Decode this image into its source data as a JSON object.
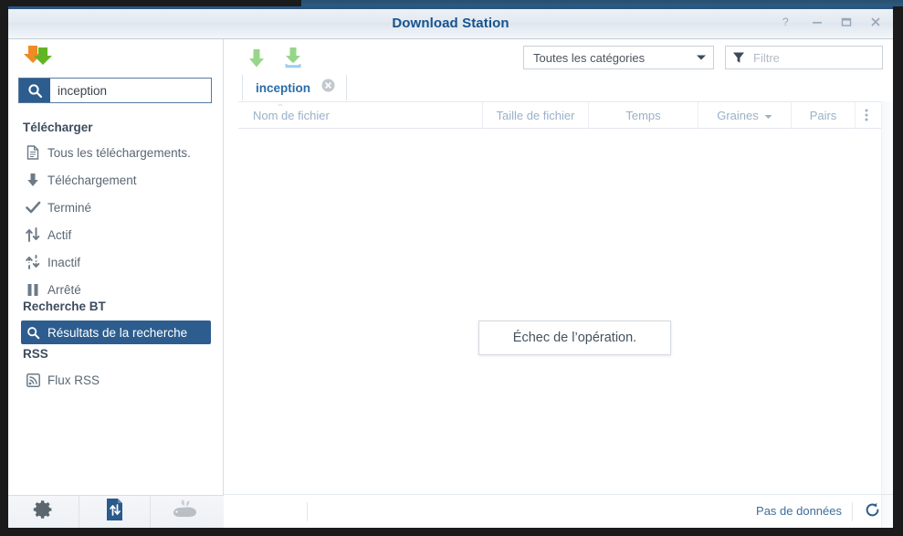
{
  "window": {
    "title": "Download Station",
    "controls": [
      {
        "name": "help-button",
        "icon": "question-icon"
      },
      {
        "name": "minimize-button",
        "icon": "minimize-icon"
      },
      {
        "name": "maximize-button",
        "icon": "maximize-icon"
      },
      {
        "name": "close-button",
        "icon": "close-icon"
      }
    ]
  },
  "sidebar": {
    "search": {
      "value": "inception",
      "placeholder": "",
      "icon": "search-icon",
      "clear_icon": "clear-circle-icon"
    },
    "groups": [
      {
        "title": "Télécharger",
        "items": [
          {
            "label": "Tous les téléchargements.",
            "icon": "document-icon",
            "selected": false
          },
          {
            "label": "Téléchargement",
            "icon": "download-arrow-icon",
            "selected": false
          },
          {
            "label": "Terminé",
            "icon": "check-icon",
            "selected": false
          },
          {
            "label": "Actif",
            "icon": "up-down-arrows-icon",
            "selected": false
          },
          {
            "label": "Inactif",
            "icon": "broken-arrows-icon",
            "selected": false
          },
          {
            "label": "Arrêté",
            "icon": "pause-icon",
            "selected": false
          }
        ]
      },
      {
        "title": "Recherche BT",
        "items": [
          {
            "label": "Résultats de la recherche",
            "icon": "magnifier-icon",
            "selected": true
          }
        ]
      },
      {
        "title": "RSS",
        "items": [
          {
            "label": "Flux RSS",
            "icon": "rss-icon",
            "selected": false
          }
        ]
      }
    ],
    "bottom_buttons": [
      {
        "name": "settings-button",
        "icon": "gear-icon"
      },
      {
        "name": "transfer-schedule-button",
        "icon": "file-transfer-icon"
      },
      {
        "name": "bt-search-engine-button",
        "icon": "rabbit-icon"
      }
    ]
  },
  "toolbar": {
    "download_button_label": "",
    "download_icon": "green-down-arrow-icon",
    "download_to_icon": "green-down-arrow-tray-icon",
    "category": {
      "selected": "Toutes les catégories",
      "caret_icon": "chevron-down-icon"
    },
    "filter": {
      "placeholder": "Filtre",
      "value": "",
      "icon": "funnel-icon"
    }
  },
  "tabs": [
    {
      "label": "inception",
      "active": true,
      "close_icon": "close-circle-icon"
    }
  ],
  "table": {
    "columns": [
      {
        "key": "filename",
        "label": "Nom de fichier"
      },
      {
        "key": "filesize",
        "label": "Taille de fichier"
      },
      {
        "key": "time",
        "label": "Temps"
      },
      {
        "key": "seeds",
        "label": "Graines",
        "sorted": true,
        "sort_icon": "caret-down-icon"
      },
      {
        "key": "peers",
        "label": "Pairs"
      }
    ],
    "menu_icon": "column-options-icon",
    "rows": []
  },
  "toast": {
    "message": "Échec de l’opération."
  },
  "statusbar": {
    "text": "Pas de données",
    "refresh_icon": "refresh-icon"
  },
  "colors": {
    "accent": "#2d5d8e",
    "title": "#16538f",
    "tab_active": "#2a6ca8",
    "status_text": "#3d6e9c",
    "header_text": "#9bb0c7",
    "icon_green": "#96d68a",
    "icon_blue": "#9ecdf0",
    "icon_orange": "#f08a24"
  }
}
